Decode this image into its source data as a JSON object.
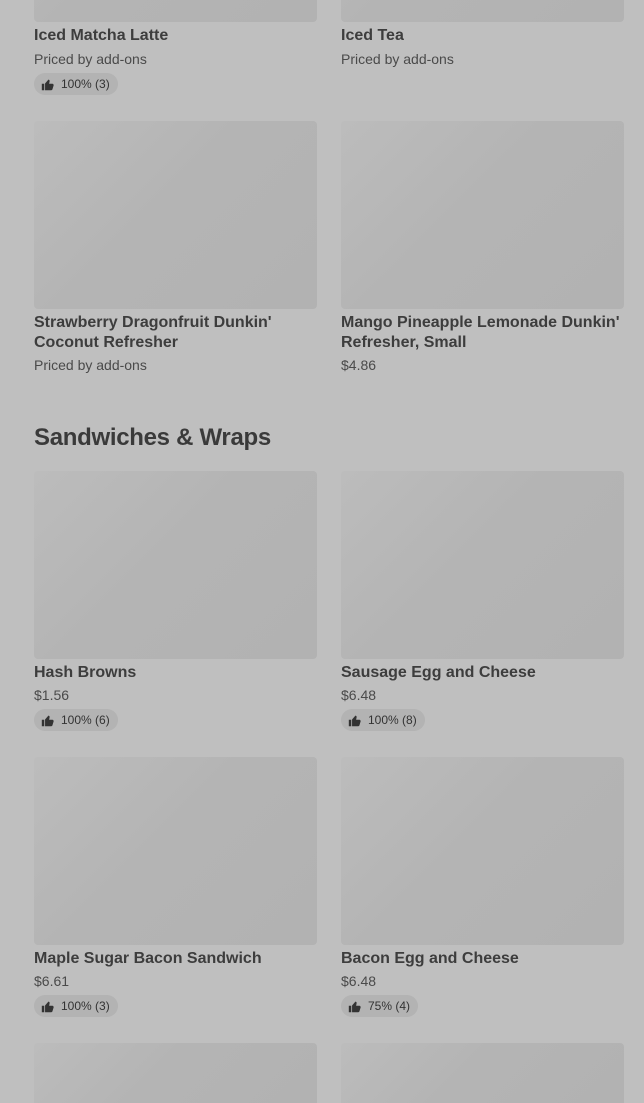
{
  "rating_icon": "thumbs-up-icon",
  "top_items": [
    {
      "name": "Iced Matcha Latte",
      "price": "Priced by add-ons",
      "rating": "100% (3)"
    },
    {
      "name": "Iced Tea",
      "price": "Priced by add-ons"
    },
    {
      "name": "Strawberry Dragonfruit Dunkin' Coconut Refresher",
      "price": "Priced by add-ons"
    },
    {
      "name": "Mango Pineapple Lemonade Dunkin' Refresher, Small",
      "price": "$4.86"
    }
  ],
  "sandwiches": {
    "title": "Sandwiches & Wraps",
    "items": [
      {
        "name": "Hash Browns",
        "price": "$1.56",
        "rating": "100% (6)"
      },
      {
        "name": "Sausage Egg and Cheese",
        "price": "$6.48",
        "rating": "100% (8)"
      },
      {
        "name": "Maple Sugar Bacon Sandwich",
        "price": "$6.61",
        "rating": "100% (3)"
      },
      {
        "name": "Bacon Egg and Cheese",
        "price": "$6.48",
        "rating": "75% (4)"
      }
    ]
  }
}
